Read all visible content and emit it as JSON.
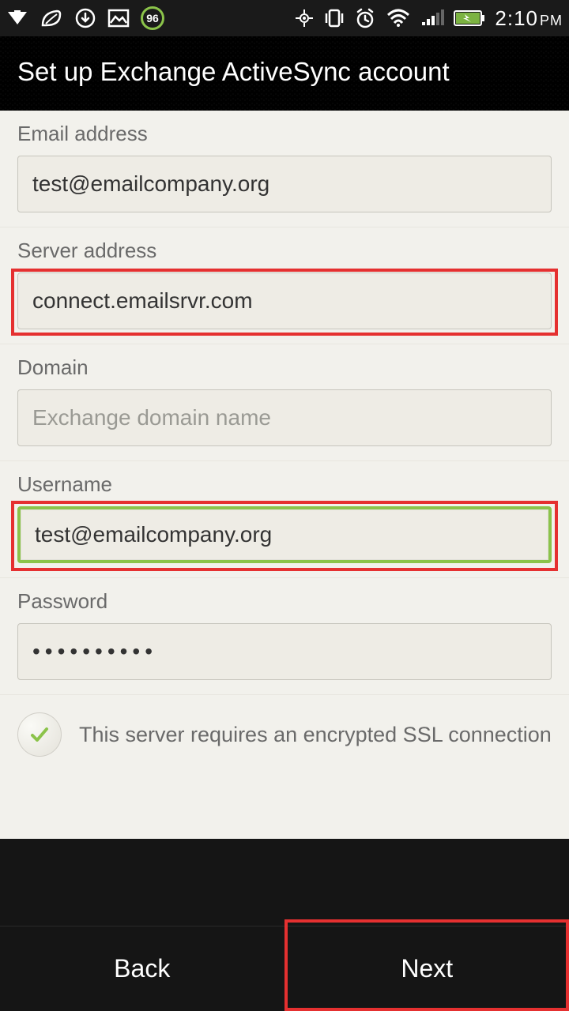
{
  "status": {
    "badge": "96",
    "time": "2:10",
    "ampm": "PM"
  },
  "header": {
    "title": "Set up Exchange ActiveSync account"
  },
  "fields": {
    "email": {
      "label": "Email address",
      "value": "test@emailcompany.org"
    },
    "server": {
      "label": "Server address",
      "value": "connect.emailsrvr.com"
    },
    "domain": {
      "label": "Domain",
      "placeholder": "Exchange domain name",
      "value": ""
    },
    "username": {
      "label": "Username",
      "value": "test@emailcompany.org"
    },
    "password": {
      "label": "Password",
      "value": "••••••••••"
    }
  },
  "ssl": {
    "text": "This server requires an encrypted SSL connection"
  },
  "footer": {
    "back": "Back",
    "next": "Next"
  }
}
